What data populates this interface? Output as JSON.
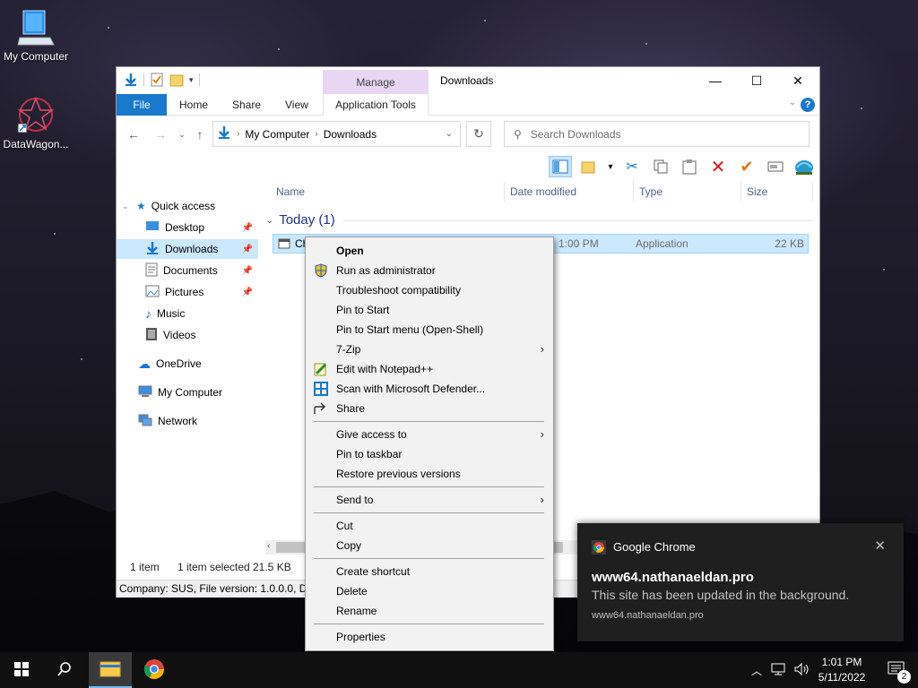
{
  "desktop": {
    "icons": [
      {
        "label": "My Computer"
      },
      {
        "label": "DataWagon..."
      }
    ]
  },
  "window": {
    "title": "Downloads",
    "manage_tab": "Manage",
    "tabs": [
      "File",
      "Home",
      "Share",
      "View",
      "Application Tools"
    ],
    "address": {
      "root": "My Computer",
      "current": "Downloads"
    },
    "search_placeholder": "Search Downloads",
    "nav": {
      "quick_access": "Quick access",
      "items": [
        "Desktop",
        "Downloads",
        "Documents",
        "Pictures",
        "Music",
        "Videos"
      ],
      "onedrive": "OneDrive",
      "my_computer": "My Computer",
      "network": "Network"
    },
    "columns": {
      "name": "Name",
      "date": "Date modified",
      "type": "Type",
      "size": "Size"
    },
    "group": "Today (1)",
    "file": {
      "name": "Ch",
      "date": "1:00 PM",
      "type": "Application",
      "size": "22 KB"
    },
    "status": {
      "count": "1 item",
      "selected": "1 item selected",
      "size": "21.5 KB"
    },
    "details": "Company: SUS, File version: 1.0.0.0, Date"
  },
  "context_menu": {
    "open": "Open",
    "run_admin": "Run as administrator",
    "troubleshoot": "Troubleshoot compatibility",
    "pin_start": "Pin to Start",
    "pin_start_shell": "Pin to Start menu (Open-Shell)",
    "zip": "7-Zip",
    "notepad": "Edit with Notepad++",
    "defender": "Scan with Microsoft Defender...",
    "share": "Share",
    "give_access": "Give access to",
    "pin_taskbar": "Pin to taskbar",
    "restore": "Restore previous versions",
    "send_to": "Send to",
    "cut": "Cut",
    "copy": "Copy",
    "create_shortcut": "Create shortcut",
    "delete": "Delete",
    "rename": "Rename",
    "properties": "Properties"
  },
  "toast": {
    "app": "Google Chrome",
    "heading": "www64.nathanaeldan.pro",
    "body": "This site has been updated in the background.",
    "source": "www64.nathanaeldan.pro"
  },
  "taskbar": {
    "time": "1:01 PM",
    "date": "5/11/2022",
    "notification_count": "2"
  },
  "colors": {
    "accent": "#1979ca",
    "selection": "#cce8ff",
    "manage_tab": "#e8d6f2",
    "toast_bg": "#1f1f1f"
  }
}
